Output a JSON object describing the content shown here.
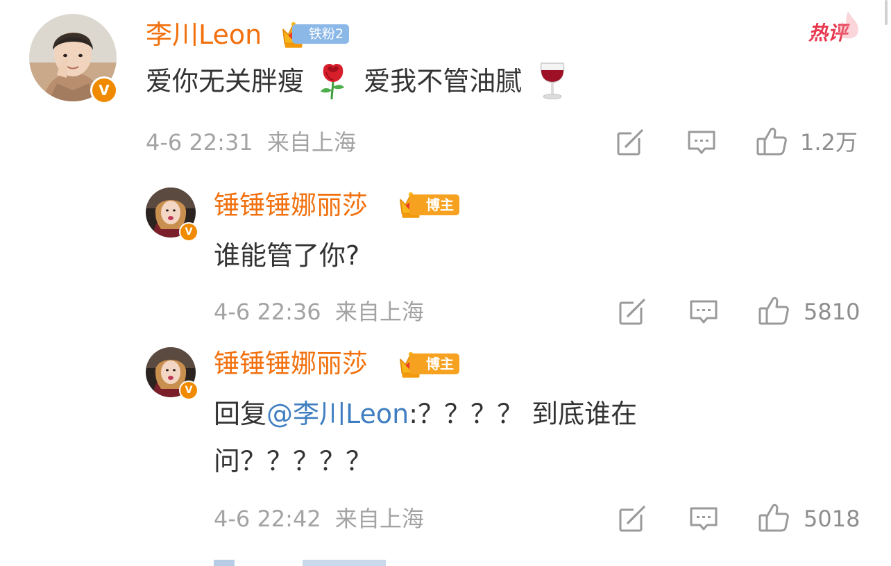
{
  "hot_label": "热评",
  "colors": {
    "username": "#f2700d",
    "text": "#333333",
    "meta": "#a3a3a3",
    "mention": "#3f7fc1",
    "verified_badge": "#f08a00",
    "hot_tag": "#e8384f"
  },
  "comment": {
    "author": "李川Leon",
    "fan_badge": "铁粉2",
    "avatar_icon": "user-avatar",
    "verified_mark": "V",
    "text_part1": "爱你无关胖瘦",
    "emoji1": "rose",
    "text_part2": "爱我不管油腻",
    "emoji2": "wine-glass",
    "timestamp": "4-6 22:31",
    "location": "来自上海",
    "likes": "1.2万"
  },
  "replies": [
    {
      "author": "锤锤锤娜丽莎",
      "badge": "博主",
      "verified_mark": "V",
      "text": "谁能管了你?",
      "timestamp": "4-6 22:36",
      "location": "来自上海",
      "likes": "5810"
    },
    {
      "author": "锤锤锤娜丽莎",
      "badge": "博主",
      "verified_mark": "V",
      "reply_prefix": "回复",
      "mention": "@李川Leon",
      "text_line1": ":？？？？ 到底谁在",
      "text_line2": "问？？？？？",
      "timestamp": "4-6 22:42",
      "location": "来自上海",
      "likes": "5018"
    }
  ]
}
